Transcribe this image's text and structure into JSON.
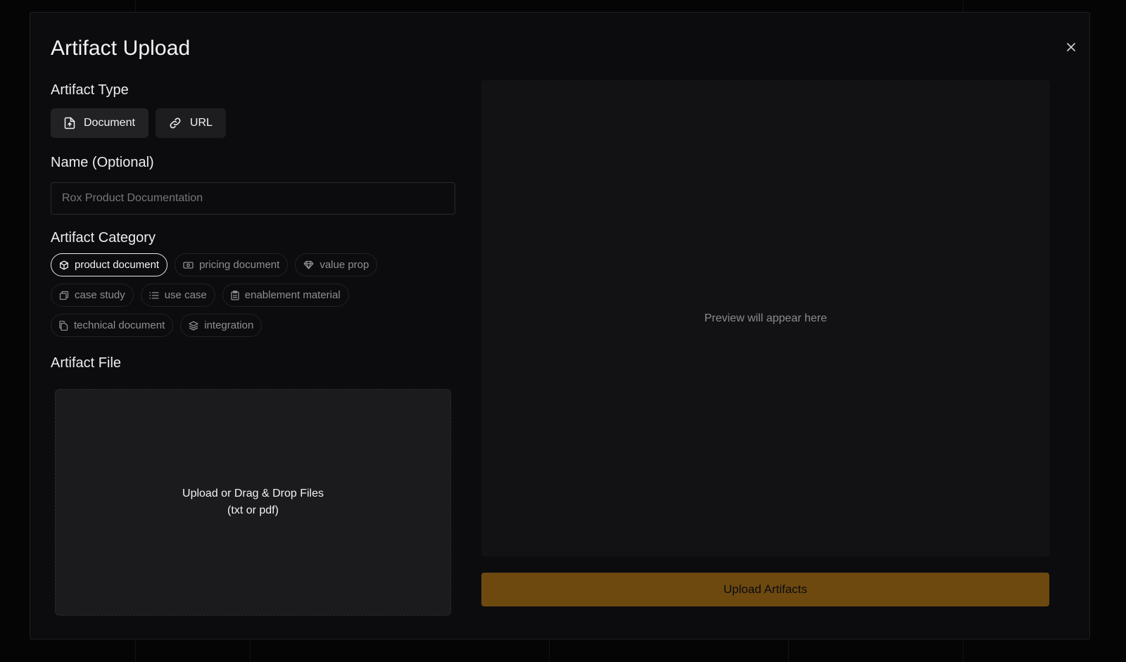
{
  "modal": {
    "title": "Artifact Upload"
  },
  "artifact_type": {
    "label": "Artifact Type",
    "options": [
      {
        "label": "Document",
        "icon": "file-upload-icon"
      },
      {
        "label": "URL",
        "icon": "link-icon"
      }
    ],
    "selected": "Document"
  },
  "name_field": {
    "label": "Name (Optional)",
    "value": "",
    "placeholder": "Rox Product Documentation"
  },
  "artifact_category": {
    "label": "Artifact Category",
    "rows": [
      [
        {
          "label": "product document",
          "icon": "box-icon"
        },
        {
          "label": "pricing document",
          "icon": "banknote-icon"
        },
        {
          "label": "value prop",
          "icon": "gem-icon"
        }
      ],
      [
        {
          "label": "case study",
          "icon": "copy-icon"
        },
        {
          "label": "use case",
          "icon": "list-icon"
        },
        {
          "label": "enablement material",
          "icon": "clipboard-icon"
        }
      ],
      [
        {
          "label": "technical document",
          "icon": "files-icon"
        },
        {
          "label": "integration",
          "icon": "layers-icon"
        }
      ]
    ],
    "selected": "product document"
  },
  "artifact_file": {
    "label": "Artifact File",
    "dropzone_line1": "Upload or Drag & Drop Files",
    "dropzone_line2": "(txt or pdf)"
  },
  "preview": {
    "placeholder": "Preview will appear here"
  },
  "actions": {
    "upload_label": "Upload Artifacts"
  },
  "colors": {
    "accent": "#6d4910",
    "background": "#0c0c0e",
    "backdrop": "#050506"
  }
}
